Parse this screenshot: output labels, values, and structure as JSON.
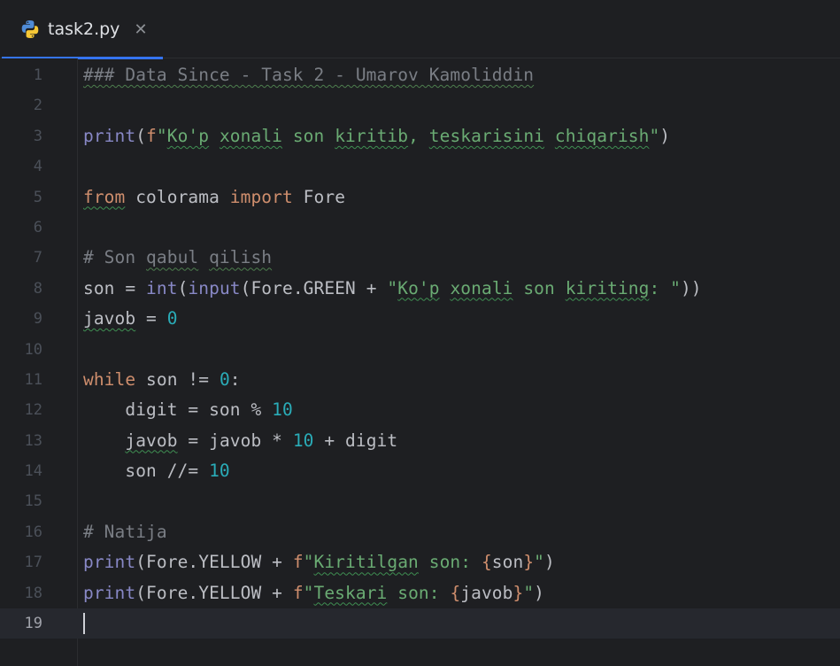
{
  "tab": {
    "title": "task2.py",
    "close_glyph": "✕",
    "icon": "python-icon",
    "underline_color": "#3574f0"
  },
  "colors": {
    "background": "#1e1f22",
    "comment": "#7a7e85",
    "keyword": "#cf8e6d",
    "builtin": "#8888c6",
    "string": "#6aab73",
    "number": "#2aacb8",
    "identifier": "#bcbec4"
  },
  "current_line": 19,
  "lines": [
    {
      "n": "1",
      "tokens": [
        {
          "t": "### Data Since - Task 2 - Umarov Kamoliddin",
          "c": "cm",
          "typo": "cm"
        }
      ]
    },
    {
      "n": "2",
      "tokens": []
    },
    {
      "n": "3",
      "tokens": [
        {
          "t": "print",
          "c": "fn"
        },
        {
          "t": "(",
          "c": "id"
        },
        {
          "t": "f",
          "c": "kw"
        },
        {
          "t": "\"",
          "c": "str"
        },
        {
          "t": "Ko'p",
          "c": "str",
          "typo": "y"
        },
        {
          "t": " ",
          "c": "str"
        },
        {
          "t": "xonali",
          "c": "str",
          "typo": "y"
        },
        {
          "t": " son ",
          "c": "str"
        },
        {
          "t": "kiritib",
          "c": "str",
          "typo": "y"
        },
        {
          "t": ", ",
          "c": "str"
        },
        {
          "t": "teskarisini",
          "c": "str",
          "typo": "y"
        },
        {
          "t": " ",
          "c": "str"
        },
        {
          "t": "chiqarish",
          "c": "str",
          "typo": "y"
        },
        {
          "t": "\"",
          "c": "str"
        },
        {
          "t": ")",
          "c": "id"
        }
      ]
    },
    {
      "n": "4",
      "tokens": []
    },
    {
      "n": "5",
      "tokens": [
        {
          "t": "from",
          "c": "kw",
          "typo": "y"
        },
        {
          "t": " colorama ",
          "c": "id"
        },
        {
          "t": "import",
          "c": "kw"
        },
        {
          "t": " Fore",
          "c": "id"
        }
      ]
    },
    {
      "n": "6",
      "tokens": []
    },
    {
      "n": "7",
      "tokens": [
        {
          "t": "# Son ",
          "c": "cm"
        },
        {
          "t": "qabul",
          "c": "cm",
          "typo": "cm"
        },
        {
          "t": " ",
          "c": "cm"
        },
        {
          "t": "qilish",
          "c": "cm",
          "typo": "cm"
        }
      ]
    },
    {
      "n": "8",
      "tokens": [
        {
          "t": "son = ",
          "c": "id"
        },
        {
          "t": "int",
          "c": "fn"
        },
        {
          "t": "(",
          "c": "id"
        },
        {
          "t": "input",
          "c": "fn"
        },
        {
          "t": "(Fore.GREEN + ",
          "c": "id"
        },
        {
          "t": "\"",
          "c": "str"
        },
        {
          "t": "Ko'p",
          "c": "str",
          "typo": "y"
        },
        {
          "t": " ",
          "c": "str"
        },
        {
          "t": "xonali",
          "c": "str",
          "typo": "y"
        },
        {
          "t": " son ",
          "c": "str"
        },
        {
          "t": "kiriting",
          "c": "str",
          "typo": "y"
        },
        {
          "t": ": \"",
          "c": "str"
        },
        {
          "t": "))",
          "c": "id"
        }
      ]
    },
    {
      "n": "9",
      "tokens": [
        {
          "t": "javob",
          "c": "id",
          "typo": "y"
        },
        {
          "t": " = ",
          "c": "id"
        },
        {
          "t": "0",
          "c": "num"
        }
      ]
    },
    {
      "n": "10",
      "tokens": []
    },
    {
      "n": "11",
      "tokens": [
        {
          "t": "while",
          "c": "kw"
        },
        {
          "t": " son != ",
          "c": "id"
        },
        {
          "t": "0",
          "c": "num"
        },
        {
          "t": ":",
          "c": "id"
        }
      ]
    },
    {
      "n": "12",
      "tokens": [
        {
          "t": "    digit = son % ",
          "c": "id"
        },
        {
          "t": "10",
          "c": "num"
        }
      ]
    },
    {
      "n": "13",
      "tokens": [
        {
          "t": "    ",
          "c": "id"
        },
        {
          "t": "javob",
          "c": "id",
          "typo": "y"
        },
        {
          "t": " = javob * ",
          "c": "id"
        },
        {
          "t": "10",
          "c": "num"
        },
        {
          "t": " + digit",
          "c": "id"
        }
      ]
    },
    {
      "n": "14",
      "tokens": [
        {
          "t": "    son //= ",
          "c": "id"
        },
        {
          "t": "10",
          "c": "num"
        }
      ]
    },
    {
      "n": "15",
      "tokens": []
    },
    {
      "n": "16",
      "tokens": [
        {
          "t": "# Natija",
          "c": "cm"
        }
      ]
    },
    {
      "n": "17",
      "tokens": [
        {
          "t": "print",
          "c": "fn"
        },
        {
          "t": "(Fore.YELLOW + ",
          "c": "id"
        },
        {
          "t": "f",
          "c": "kw"
        },
        {
          "t": "\"",
          "c": "str"
        },
        {
          "t": "Kiritilgan",
          "c": "str",
          "typo": "y"
        },
        {
          "t": " son: ",
          "c": "str"
        },
        {
          "t": "{",
          "c": "br"
        },
        {
          "t": "son",
          "c": "id"
        },
        {
          "t": "}",
          "c": "br"
        },
        {
          "t": "\"",
          "c": "str"
        },
        {
          "t": ")",
          "c": "id"
        }
      ]
    },
    {
      "n": "18",
      "tokens": [
        {
          "t": "print",
          "c": "fn"
        },
        {
          "t": "(Fore.YELLOW + ",
          "c": "id"
        },
        {
          "t": "f",
          "c": "kw"
        },
        {
          "t": "\"",
          "c": "str"
        },
        {
          "t": "Teskari",
          "c": "str",
          "typo": "y"
        },
        {
          "t": " son: ",
          "c": "str"
        },
        {
          "t": "{",
          "c": "br"
        },
        {
          "t": "javob",
          "c": "id"
        },
        {
          "t": "}",
          "c": "br"
        },
        {
          "t": "\"",
          "c": "str"
        },
        {
          "t": ")",
          "c": "id"
        }
      ]
    },
    {
      "n": "19",
      "tokens": []
    }
  ]
}
